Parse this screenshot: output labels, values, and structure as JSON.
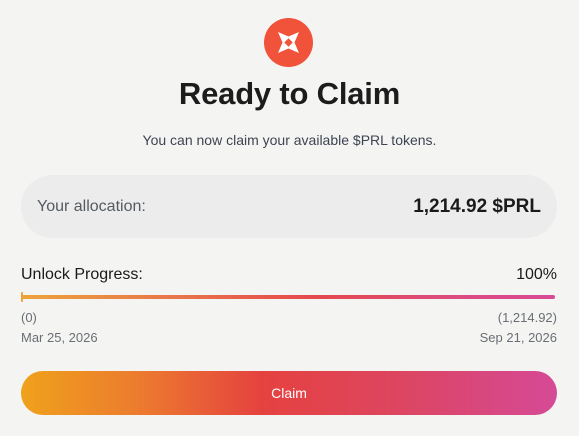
{
  "header": {
    "logo_icon": "prl-logo-icon",
    "title": "Ready to Claim",
    "subtitle": "You can now claim your available $PRL tokens."
  },
  "colors": {
    "logo_bg": "#f0523a",
    "accent_start": "#efa11c",
    "accent_mid": "#e5423f",
    "accent_end": "#d54a96"
  },
  "allocation": {
    "label": "Your allocation:",
    "value": "1,214.92 $PRL"
  },
  "progress": {
    "label": "Unlock Progress:",
    "percent_text": "100%",
    "fraction": 1.0,
    "start_value": "(0)",
    "end_value": "(1,214.92)",
    "start_date": "Mar 25, 2026",
    "end_date": "Sep 21, 2026"
  },
  "actions": {
    "claim_label": "Claim"
  }
}
